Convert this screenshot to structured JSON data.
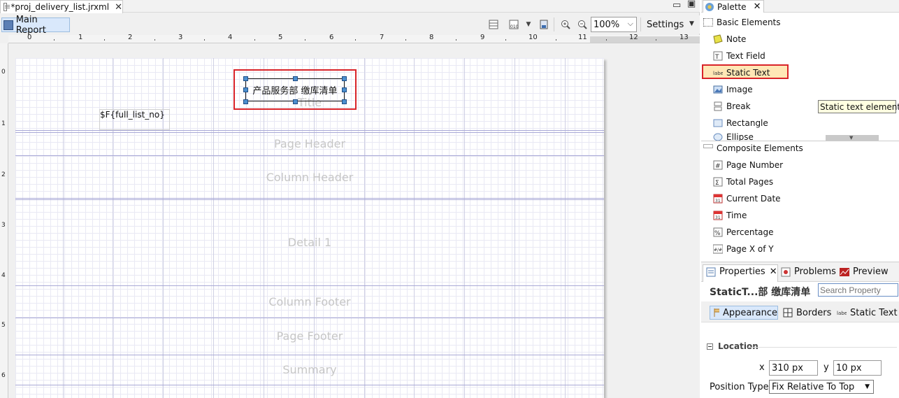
{
  "editor": {
    "tab_title": "*proj_delivery_list.jrxml",
    "main_report_label": "Main Report",
    "zoom_value": "100%",
    "settings_label": "Settings"
  },
  "ruler": {
    "h_labels": [
      "0",
      "1",
      "2",
      "3",
      "4",
      "5",
      "6",
      "7",
      "8",
      "9",
      "10",
      "11",
      "12",
      "13"
    ],
    "v_labels": [
      "0",
      "1",
      "2",
      "3",
      "4",
      "5",
      "6"
    ]
  },
  "report": {
    "static_text": "产品服务部  缴库清单",
    "field_expression": "$F{full_list_no}",
    "bands": [
      {
        "id": "title",
        "label": "Title"
      },
      {
        "id": "page-header",
        "label": "Page Header"
      },
      {
        "id": "column-header",
        "label": "Column Header"
      },
      {
        "id": "detail",
        "label": "Detail 1"
      },
      {
        "id": "column-footer",
        "label": "Column Footer"
      },
      {
        "id": "page-footer",
        "label": "Page Footer"
      },
      {
        "id": "summary",
        "label": "Summary"
      }
    ]
  },
  "palette": {
    "tab_title": "Palette",
    "basic_header": "Basic Elements",
    "basic_items": [
      "Note",
      "Text Field",
      "Static Text",
      "Image",
      "Break",
      "Rectangle",
      "Ellipse"
    ],
    "composite_header": "Composite Elements",
    "composite_items": [
      "Page Number",
      "Total Pages",
      "Current Date",
      "Time",
      "Percentage",
      "Page X of Y"
    ],
    "tooltip": "Static text element"
  },
  "properties": {
    "tabs": [
      "Properties",
      "Problems",
      "Preview"
    ],
    "title": "StaticT...部  缴库清单",
    "search_placeholder": "Search Property",
    "subtabs": [
      "Appearance",
      "Borders",
      "Static Text"
    ],
    "section_location": "Location",
    "x_label": "x",
    "x_value": "310 px",
    "y_label": "y",
    "y_value": "10 px",
    "position_type_label": "Position Type",
    "position_type_value": "Fix Relative To Top"
  },
  "colors": {
    "highlight_red": "#d9242a",
    "selection_blue": "#d9e8fb",
    "band_line": "#a9a9d6"
  }
}
